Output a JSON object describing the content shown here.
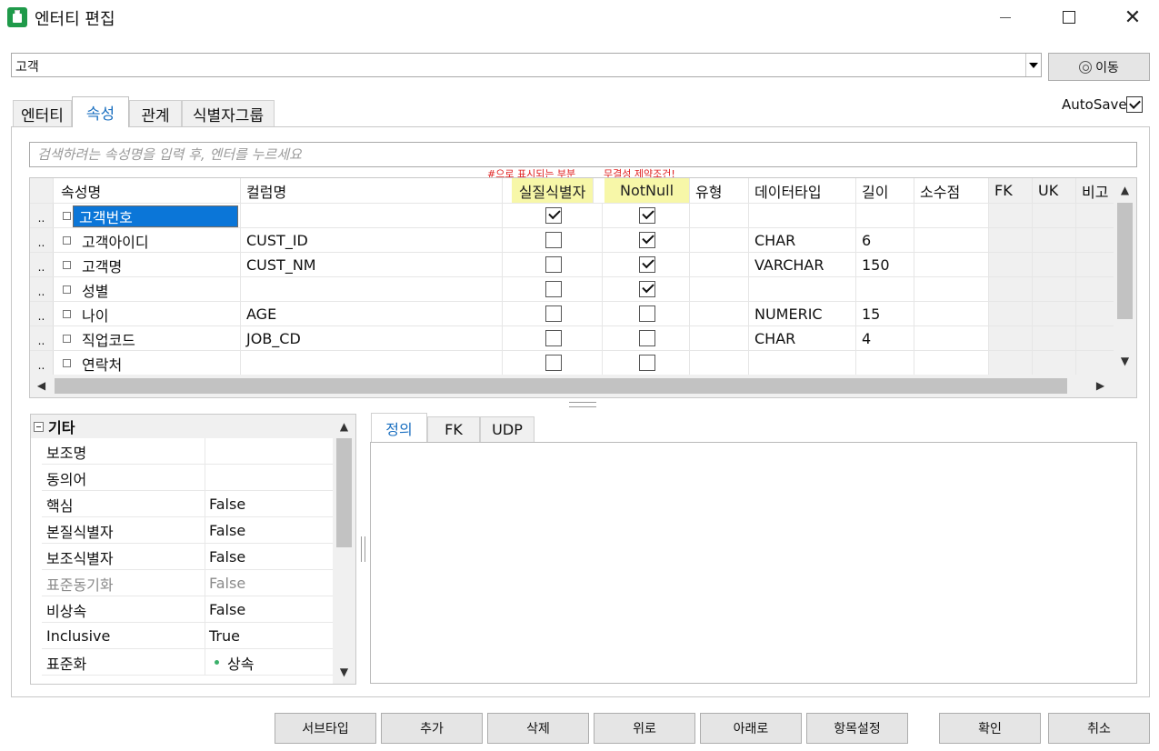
{
  "window": {
    "title": "엔터티 편집"
  },
  "entity_selector": {
    "value": "고객",
    "goto_label": "이동"
  },
  "autosave": {
    "label": "AutoSave",
    "checked": true
  },
  "tabs": [
    {
      "label": "엔터티",
      "active": false
    },
    {
      "label": "속성",
      "active": true
    },
    {
      "label": "관계",
      "active": false
    },
    {
      "label": "식별자그룹",
      "active": false
    }
  ],
  "search": {
    "placeholder": "검색하려는 속성명을 입력 후, 엔터를 누르세요"
  },
  "annotations": {
    "pk_note": "#으로 표시되는 부분",
    "notnull_note": "무결성 제약조건!"
  },
  "grid": {
    "headers": {
      "name": "속성명",
      "column": "컬럼명",
      "pk": "실질식별자",
      "notnull": "NotNull",
      "kind": "유형",
      "datatype": "데이터타입",
      "length": "길이",
      "scale": "소수점",
      "fk": "FK",
      "uk": "UK",
      "note": "비고"
    },
    "rows": [
      {
        "marker": "..",
        "name": "고객번호",
        "column": "",
        "pk": true,
        "notnull": true,
        "kind": "",
        "datatype": "",
        "length": "",
        "scale": "",
        "editing": true
      },
      {
        "marker": "..",
        "name": "고객아이디",
        "column": "CUST_ID",
        "pk": false,
        "notnull": true,
        "kind": "",
        "datatype": "CHAR",
        "length": "6",
        "scale": ""
      },
      {
        "marker": "..",
        "name": "고객명",
        "column": "CUST_NM",
        "pk": false,
        "notnull": true,
        "kind": "",
        "datatype": "VARCHAR",
        "length": "150",
        "scale": ""
      },
      {
        "marker": "..",
        "name": "성별",
        "column": "",
        "pk": false,
        "notnull": true,
        "kind": "",
        "datatype": "",
        "length": "",
        "scale": ""
      },
      {
        "marker": "..",
        "name": "나이",
        "column": "AGE",
        "pk": false,
        "notnull": false,
        "kind": "",
        "datatype": "NUMERIC",
        "length": "15",
        "scale": ""
      },
      {
        "marker": "..",
        "name": "직업코드",
        "column": "JOB_CD",
        "pk": false,
        "notnull": false,
        "kind": "",
        "datatype": "CHAR",
        "length": "4",
        "scale": ""
      },
      {
        "marker": "..",
        "name": "연락처",
        "column": "",
        "pk": false,
        "notnull": false,
        "kind": "",
        "datatype": "",
        "length": "",
        "scale": ""
      }
    ]
  },
  "properties": {
    "category": "기타",
    "items": [
      {
        "name": "보조명",
        "value": ""
      },
      {
        "name": "동의어",
        "value": ""
      },
      {
        "name": "핵심",
        "value": "False"
      },
      {
        "name": "본질식별자",
        "value": "False"
      },
      {
        "name": "보조식별자",
        "value": "False"
      },
      {
        "name": "표준동기화",
        "value": "False",
        "disabled": true
      },
      {
        "name": "비상속",
        "value": "False"
      },
      {
        "name": "Inclusive",
        "value": "True"
      },
      {
        "name": "표준화",
        "value": "상속",
        "dot_color": "#3bb06a"
      }
    ]
  },
  "detail_tabs": [
    {
      "label": "정의",
      "active": true
    },
    {
      "label": "FK",
      "active": false
    },
    {
      "label": "UDP",
      "active": false
    }
  ],
  "buttons": {
    "subtype": "서브타입",
    "add": "추가",
    "delete": "삭제",
    "up": "위로",
    "down": "아래로",
    "item_settings": "항목설정",
    "ok": "확인",
    "cancel": "취소"
  },
  "colors": {
    "accent": "#1a6fc0",
    "selection": "#0b76d8",
    "highlight_header": "#f7f7a8",
    "annotation": "#e02020"
  }
}
